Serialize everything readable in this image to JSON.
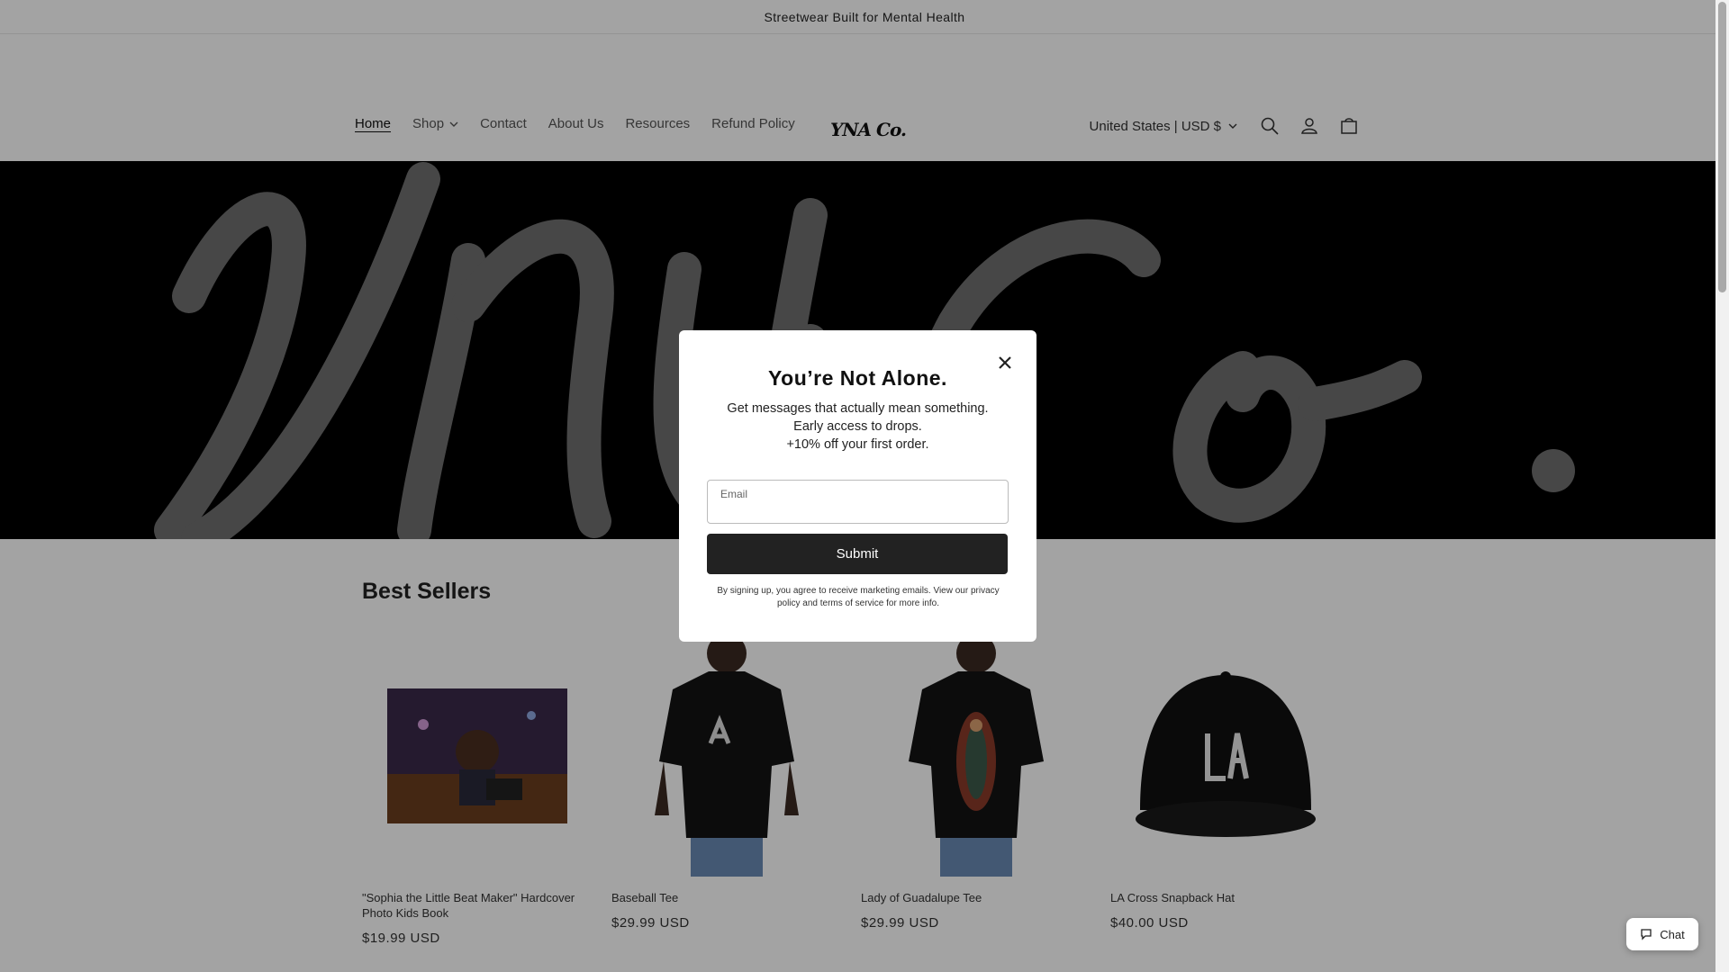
{
  "announcement": "Streetwear Built for Mental Health",
  "nav": {
    "items": [
      {
        "label": "Home"
      },
      {
        "label": "Shop"
      },
      {
        "label": "Contact"
      },
      {
        "label": "About Us"
      },
      {
        "label": "Resources"
      },
      {
        "label": "Refund Policy"
      }
    ]
  },
  "logo": "YNA Co.",
  "header": {
    "currency": "United States | USD $"
  },
  "section": {
    "title": "Best Sellers"
  },
  "products": [
    {
      "title": "\"Sophia the Little Beat Maker\" Hardcover Photo Kids Book",
      "price": "$19.99 USD"
    },
    {
      "title": "Baseball Tee",
      "price": "$29.99 USD"
    },
    {
      "title": "Lady of Guadalupe Tee",
      "price": "$29.99 USD"
    },
    {
      "title": "LA Cross Snapback Hat",
      "price": "$40.00 USD"
    }
  ],
  "modal": {
    "title": "You’re Not Alone.",
    "line1": "Get messages that actually mean something.",
    "line2": "Early access to drops.",
    "line3": "+10% off your first order.",
    "email_label": "Email",
    "submit_label": "Submit",
    "legal": "By signing up, you agree to receive marketing emails. View our privacy policy and terms of service for more info."
  },
  "chat": {
    "label": "Chat"
  },
  "colors": {
    "hero_bg": "#000000",
    "hero_script": "#777777",
    "button": "#222222"
  }
}
